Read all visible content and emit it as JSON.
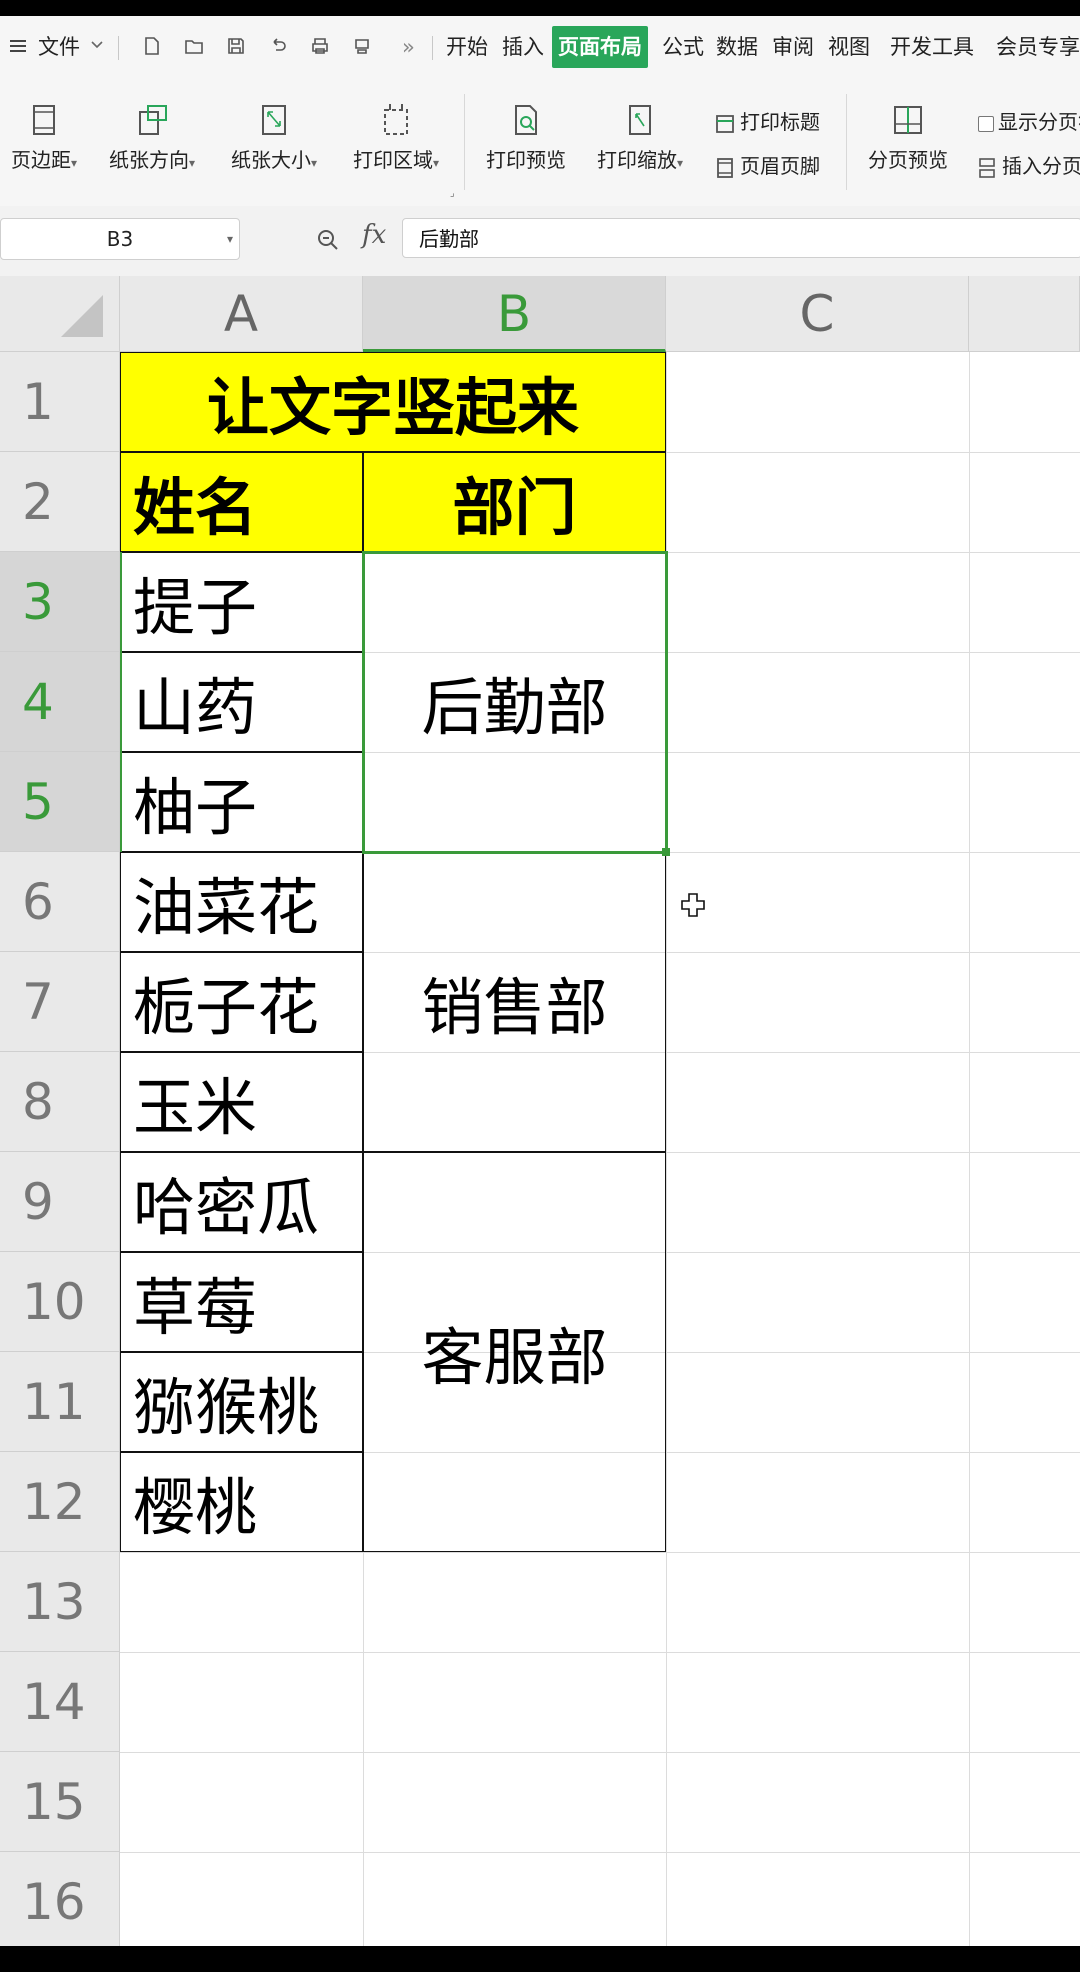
{
  "menubar": {
    "file_label": "文件",
    "more_glyph": "»",
    "tabs": [
      "开始",
      "插入",
      "页面布局",
      "公式",
      "数据",
      "审阅",
      "视图",
      "开发工具",
      "会员专享"
    ],
    "active_tab": "页面布局"
  },
  "ribbon": {
    "margins": "页边距",
    "orientation": "纸张方向",
    "size": "纸张大小",
    "print_area": "打印区域",
    "print_preview": "打印预览",
    "print_scale": "打印缩放",
    "print_titles": "打印标题",
    "header_footer": "页眉页脚",
    "page_break_preview": "分页预览",
    "show_page_breaks": "显示分页符",
    "insert_page_break": "插入分页符"
  },
  "formula_bar": {
    "name_box": "B3",
    "fx_label": "fx",
    "formula_value": "后勤部"
  },
  "sheet": {
    "columns": [
      "A",
      "B",
      "C"
    ],
    "selected_column": "B",
    "rows": [
      "1",
      "2",
      "3",
      "4",
      "5",
      "6",
      "7",
      "8",
      "9",
      "10",
      "11",
      "12",
      "13",
      "14",
      "15",
      "16"
    ],
    "selected_rows": [
      "3",
      "4",
      "5"
    ],
    "title": "让文字竖起来",
    "header_name": "姓名",
    "header_dept": "部门",
    "names": [
      "提子",
      "山药",
      "柚子",
      "油菜花",
      "栀子花",
      "玉米",
      "哈密瓜",
      "草莓",
      "猕猴桃",
      "樱桃"
    ],
    "departments": [
      "后勤部",
      "销售部",
      "客服部"
    ],
    "colors": {
      "highlight_yellow": "#ffff00",
      "selection_green": "#3a9a3a",
      "accent_green": "#29a65a"
    }
  }
}
